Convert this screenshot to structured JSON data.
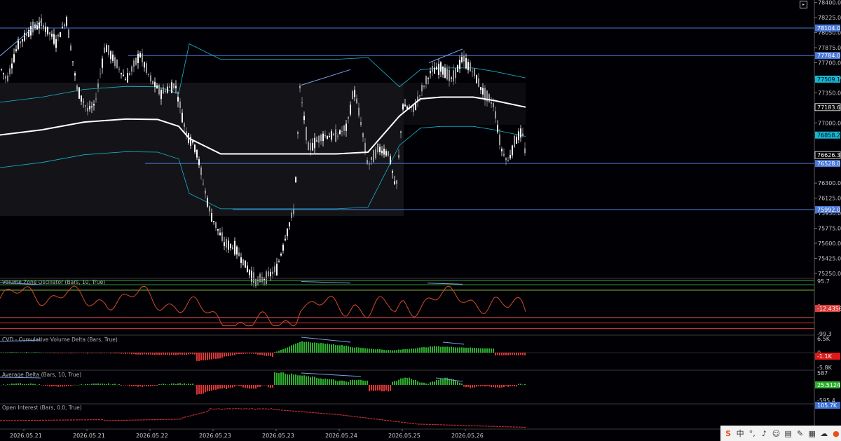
{
  "chart_data": [
    {
      "type": "candlestick",
      "title": "",
      "ylim": [
        75200,
        78430
      ],
      "y_ticks": [
        "78400.0",
        "78225.0",
        "78050.0",
        "77875.0",
        "77700.0",
        "77525.0",
        "77350.0",
        "77000.0",
        "76300.0",
        "76125.0",
        "75950.0",
        "75775.0",
        "75600.0",
        "75425.0",
        "75250.0"
      ],
      "x_dates": [
        "2026.05.21",
        "2026.05.21",
        "2026.05.22",
        "2026.05.23",
        "2026.05.23",
        "2026.05.24",
        "2026.05.25",
        "2026.05.26"
      ],
      "horizontal_levels": [
        {
          "value": 78104.0,
          "label": "78104.0",
          "color": "#4a78d8"
        },
        {
          "value": 77784.0,
          "label": "77784.0",
          "color": "#4a78d8"
        },
        {
          "value": 76528.0,
          "label": "76528.0",
          "color": "#4a78d8"
        },
        {
          "value": 75992.0,
          "label": "75992.0",
          "color": "#4a78d8"
        }
      ],
      "price_tags": [
        {
          "value": 77509.1,
          "label": "77509.1",
          "color": "#17b6d0"
        },
        {
          "value": 77183.6,
          "label": "77183.6",
          "color": "#ffffff"
        },
        {
          "value": 76858.2,
          "label": "76858.2",
          "color": "#17b6d0"
        },
        {
          "value": 76626.3,
          "label": "76626.3",
          "color": "#ffffff"
        }
      ],
      "vwap_mid": [
        [
          0,
          76860
        ],
        [
          0.08,
          76920
        ],
        [
          0.16,
          77010
        ],
        [
          0.24,
          77045
        ],
        [
          0.3,
          77040
        ],
        [
          0.34,
          76960
        ],
        [
          0.36,
          76820
        ],
        [
          0.42,
          76640
        ],
        [
          0.46,
          76640
        ],
        [
          0.52,
          76640
        ],
        [
          0.58,
          76640
        ],
        [
          0.64,
          76640
        ],
        [
          0.7,
          76660
        ],
        [
          0.76,
          77080
        ],
        [
          0.8,
          77280
        ],
        [
          0.84,
          77300
        ],
        [
          0.9,
          77300
        ],
        [
          0.94,
          77260
        ],
        [
          1.0,
          77183.6
        ]
      ]
    },
    {
      "type": "line",
      "title": "Volume Zone Oscillator (Bars, 10, True)",
      "ylim": [
        -99.3,
        95.7
      ],
      "y_ticks": [
        "95.7",
        "0",
        "-99.3"
      ],
      "levels": [
        95.7,
        80,
        60,
        -40,
        -60,
        -80
      ],
      "current": "-12.4356"
    },
    {
      "type": "bar",
      "title": "CVD - Cumulative Volume Delta (Bars, True)",
      "ylim": [
        -5800,
        6500
      ],
      "y_ticks": [
        "6.5K",
        "0",
        "-5.8K"
      ],
      "current": "-1.1K"
    },
    {
      "type": "bar",
      "title": "Average Delta (Bars, 10, True)",
      "ylim": [
        -595.4,
        587
      ],
      "y_ticks": [
        "587",
        "-595.4"
      ],
      "current": "25.5124"
    },
    {
      "type": "line",
      "title": "Open Interest (Bars, 0.0, True)",
      "current": "105.7K"
    }
  ],
  "ui": {
    "top_button": "▸",
    "tray_icons": [
      {
        "name": "sogou-icon",
        "glyph": "S"
      },
      {
        "name": "ime-chinese-icon",
        "glyph": "中"
      },
      {
        "name": "punctuation-icon",
        "glyph": "°,"
      },
      {
        "name": "microphone-icon",
        "glyph": "♪"
      },
      {
        "name": "emoji-icon",
        "glyph": "☺"
      },
      {
        "name": "keyboard-icon",
        "glyph": "▤"
      },
      {
        "name": "skin-icon",
        "glyph": "✎"
      },
      {
        "name": "toolbox-icon",
        "glyph": "▦"
      },
      {
        "name": "cloud-icon",
        "glyph": "☁"
      },
      {
        "name": "user-icon",
        "glyph": "●"
      }
    ],
    "colors": {
      "background": "#000005",
      "bull": "#ffffff",
      "bear": "#9a9a9a",
      "vwap": "#ffffff",
      "band": "#17b6d0",
      "level": "#4a78d8",
      "positive": "#2faf2f",
      "negative": "#e03535",
      "vzo": "#d24a2a"
    }
  }
}
